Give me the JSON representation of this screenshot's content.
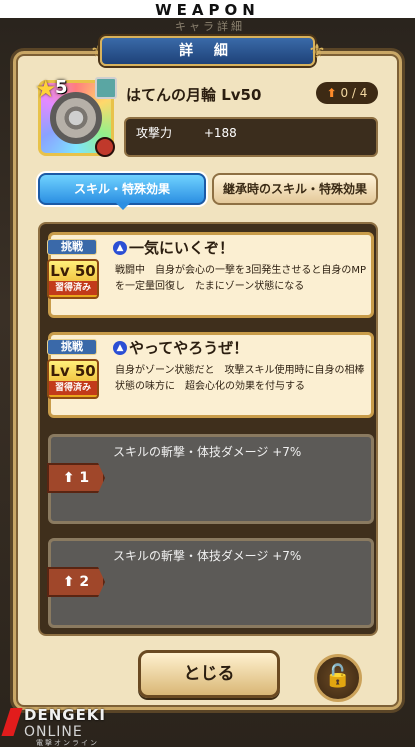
{
  "banner": {
    "title": "WEAPON"
  },
  "background": {
    "ghost_text": "キャラ詳細"
  },
  "dialog": {
    "title": "詳 細"
  },
  "item": {
    "rarity": "5",
    "name": "はてんの月輪 Lv50",
    "upgrade": "0 / 4",
    "stat_label": "攻撃力",
    "stat_value": "+188"
  },
  "tabs": {
    "active": "スキル・特殊効果",
    "inactive": "継承時のスキル・特殊効果"
  },
  "skills": [
    {
      "challenge": "挑戦",
      "level": "Lv 50",
      "learned": "習得済み",
      "name": "一気にいくぞ！",
      "desc": "戦闘中　自身が会心の一撃を3回発生させると自身のMPを一定量回復し　たまにゾーン状態になる"
    },
    {
      "challenge": "挑戦",
      "level": "Lv 50",
      "learned": "習得済み",
      "name": "やってやろうぜ！",
      "desc": "自身がゾーン状態だと　攻撃スキル使用時に自身の相棒状態の味方に　超会心化の効果を付与する"
    }
  ],
  "locked_effects": [
    {
      "text": "スキルの斬撃・体技ダメージ +7%",
      "badge": "1"
    },
    {
      "text": "スキルの斬撃・体技ダメージ +7%",
      "badge": "2"
    }
  ],
  "buttons": {
    "close": "とじる"
  },
  "watermark": {
    "line1": "DENGEKI",
    "line2": "ONLINE",
    "sub": "電撃オンライン"
  },
  "icons": [
    "star-icon",
    "wheel-weapon-icon",
    "avatar-icon",
    "element-icon",
    "up-arrow-icon",
    "lock-icon"
  ],
  "colors": {
    "accent_blue": "#2c8fe2",
    "panel_bg": "#f1e3bf",
    "locked_bg": "#5c5a57",
    "badge_gold": "#e8a419"
  }
}
